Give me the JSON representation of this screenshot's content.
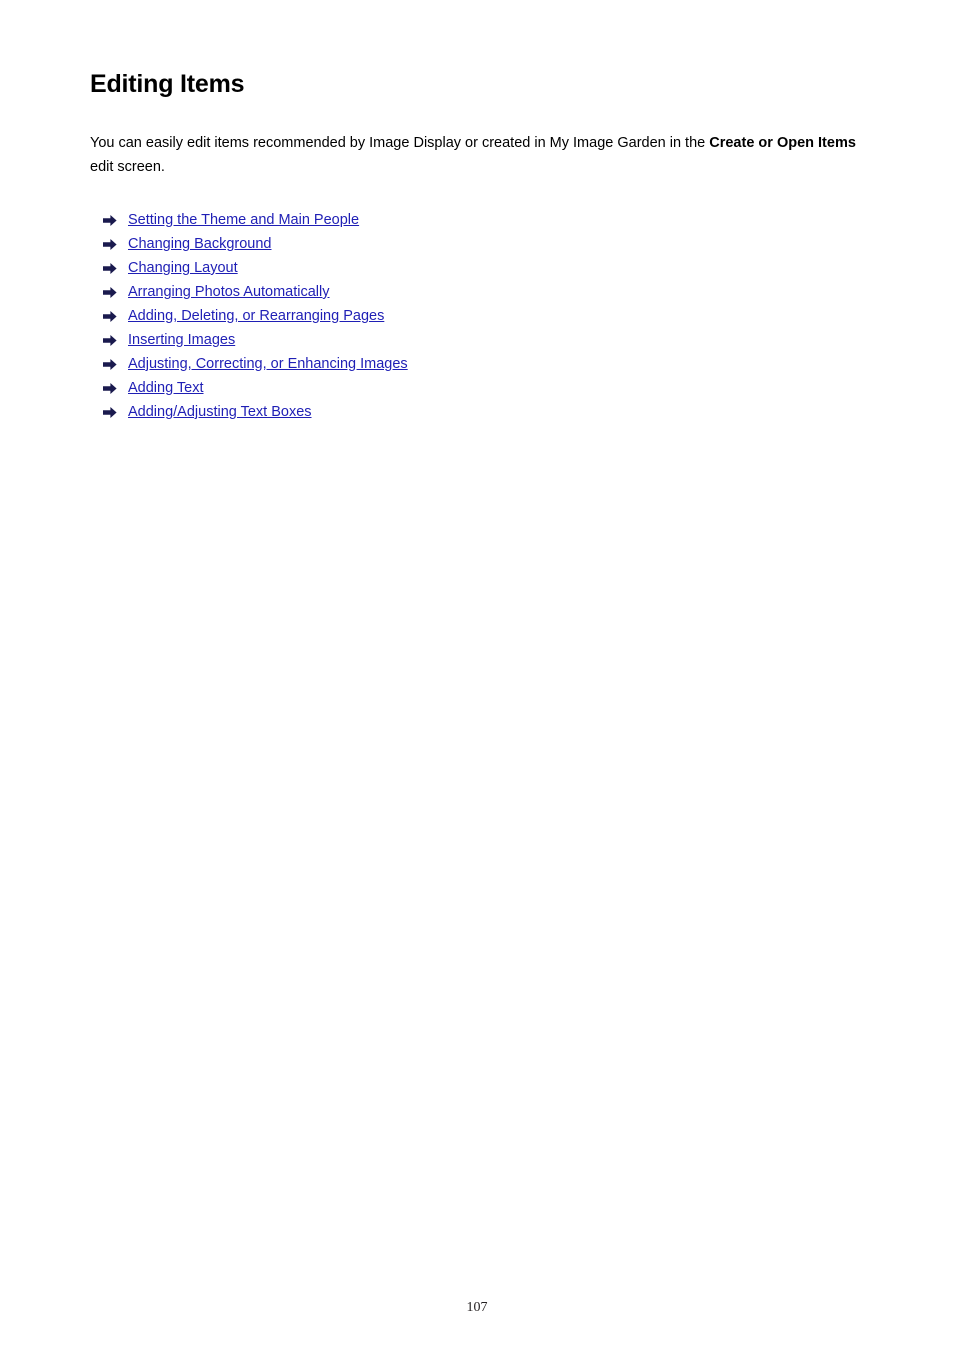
{
  "document": {
    "title": "Editing Items",
    "intro": {
      "text_before_bold": "You can easily edit items recommended by Image Display or created in My Image Garden in the ",
      "bold_text": "Create or Open Items",
      "text_after_bold": " edit screen."
    },
    "links": [
      {
        "label": "Setting the Theme and Main People",
        "icon": "arrow-right-icon"
      },
      {
        "label": "Changing Background",
        "icon": "arrow-right-icon"
      },
      {
        "label": "Changing Layout",
        "icon": "arrow-right-icon"
      },
      {
        "label": "Arranging Photos Automatically",
        "icon": "arrow-right-icon"
      },
      {
        "label": "Adding, Deleting, or Rearranging Pages",
        "icon": "arrow-right-icon"
      },
      {
        "label": "Inserting Images",
        "icon": "arrow-right-icon"
      },
      {
        "label": "Adjusting, Correcting, or Enhancing Images",
        "icon": "arrow-right-icon"
      },
      {
        "label": "Adding Text",
        "icon": "arrow-right-icon"
      },
      {
        "label": "Adding/Adjusting Text Boxes",
        "icon": "arrow-right-icon"
      }
    ],
    "page_number": "107",
    "colors": {
      "link": "#1f1fb5",
      "arrow": "#1a1a4e",
      "text": "#000000",
      "page_number": "#231f20"
    }
  }
}
